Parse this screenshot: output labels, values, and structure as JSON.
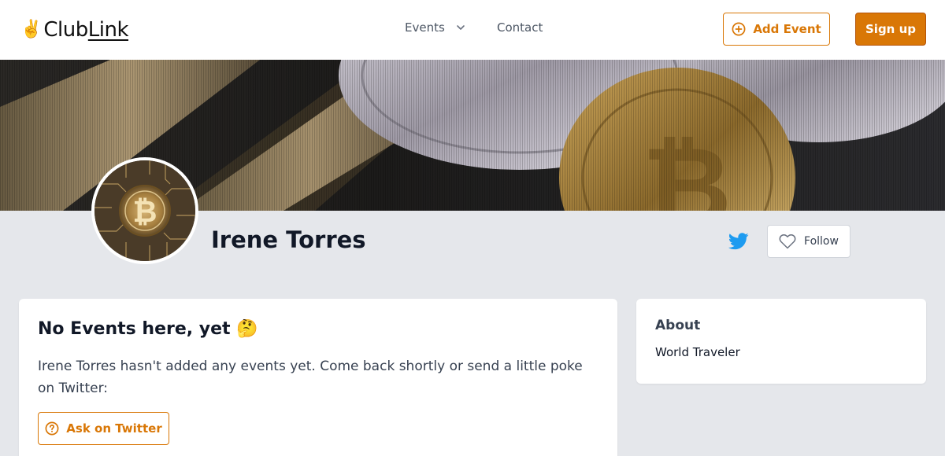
{
  "brand": {
    "logo_emoji": "✌️",
    "logo_part1": "Club",
    "logo_part2": "Link"
  },
  "nav": {
    "events_label": "Events",
    "contact_label": "Contact"
  },
  "header_actions": {
    "add_event_label": "Add Event",
    "signup_label": "Sign up"
  },
  "profile": {
    "name": "Irene Torres",
    "follow_label": "Follow"
  },
  "events_card": {
    "title": "No Events here, yet 🤔",
    "message": "Irene Torres hasn't added any events yet. Come back shortly or send a little poke on Twitter:",
    "ask_button_label": "Ask on Twitter"
  },
  "about": {
    "title": "About",
    "text": "World Traveler"
  },
  "colors": {
    "accent": "#d97706",
    "twitter": "#1d9bf0",
    "page_bg": "#e5e7eb"
  },
  "icons": [
    "peace-hand-icon",
    "chevron-down-icon",
    "plus-circle-icon",
    "twitter-icon",
    "heart-icon",
    "question-circle-icon"
  ]
}
